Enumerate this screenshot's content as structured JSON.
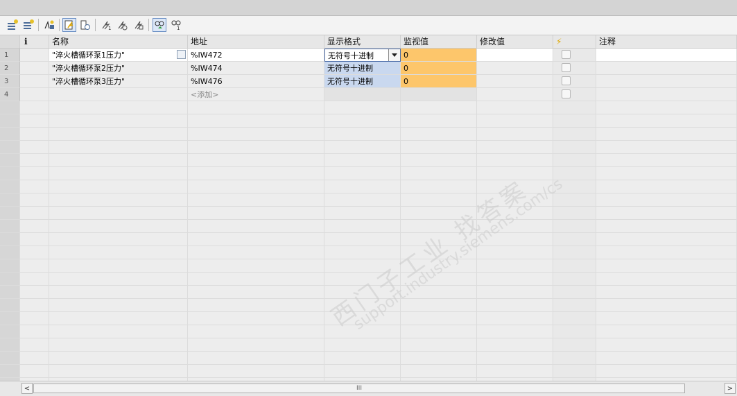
{
  "table": {
    "columns": {
      "info": "i",
      "name": "名称",
      "address": "地址",
      "format": "显示格式",
      "monitor": "监视值",
      "modify": "修改值",
      "flag": "⚡",
      "comment": "注释"
    },
    "rows": [
      {
        "num": "1",
        "name": "\"淬火槽循环泵1压力\"",
        "address": "%IW472",
        "format": "无符号十进制",
        "monitor": "0",
        "modify": ""
      },
      {
        "num": "2",
        "name": "\"淬火槽循环泵2压力\"",
        "address": "%IW474",
        "format": "无符号十进制",
        "monitor": "0",
        "modify": ""
      },
      {
        "num": "3",
        "name": "\"淬火槽循环泵3压力\"",
        "address": "%IW476",
        "format": "无符号十进制",
        "monitor": "0",
        "modify": ""
      },
      {
        "num": "4",
        "name": "",
        "address": "<添加>",
        "format": "",
        "monitor": "",
        "modify": ""
      }
    ]
  },
  "watermark": {
    "line1": "西门子工业 找答案",
    "line2": "support.industry.siemens.com/cs"
  },
  "scrollbar": {
    "left_arrow": "<",
    "right_arrow": ">",
    "thumb_grip": "III"
  },
  "colors": {
    "monitor_value_bg": "#fdc66b",
    "format_cell_bg": "#c9d8ef",
    "header_bg": "#e7e7e7",
    "grid_bg": "#ededed"
  },
  "icons": [
    "insert-row-icon",
    "add-row-icon",
    "wildcard-icon",
    "monitor-all-icon",
    "monitor-once-icon",
    "modify-once-icon",
    "modify-now-icon",
    "force-icon",
    "show-monitor-icon",
    "show-modify-icon"
  ]
}
